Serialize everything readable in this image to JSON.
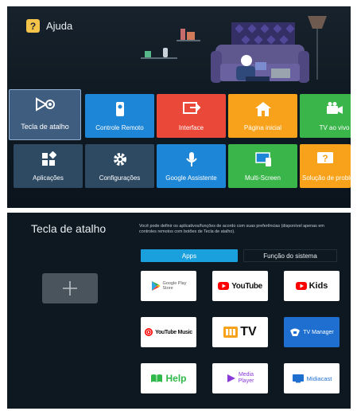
{
  "header": {
    "title": "Ajuda",
    "icon": "question-book-icon"
  },
  "tiles": [
    {
      "label": "Tecla de atalho",
      "icon": "shortcut-icon",
      "color": "#3f5d7f"
    },
    {
      "label": "Controle Remoto",
      "icon": "remote-icon",
      "color": "#1e86d6"
    },
    {
      "label": "Interface",
      "icon": "input-icon",
      "color": "#ea4838"
    },
    {
      "label": "Página inicial",
      "icon": "home-icon",
      "color": "#f7a21a"
    },
    {
      "label": "TV ao vivo",
      "icon": "tv-camera-icon",
      "color": "#39b54a"
    },
    {
      "label": "Aplicações",
      "icon": "apps-icon",
      "color": "#2e4a63"
    },
    {
      "label": "Configurações",
      "icon": "gear-icon",
      "color": "#2e4a63"
    },
    {
      "label": "Google Assistente",
      "icon": "microphone-icon",
      "color": "#1e86d6"
    },
    {
      "label": "Multi-Screen",
      "icon": "multiscreen-icon",
      "color": "#39b54a"
    },
    {
      "label": "Solução de problem...",
      "icon": "question-icon",
      "color": "#f7a21a"
    }
  ],
  "shortcut": {
    "title": "Tecla de atalho",
    "description": "Você pode definir os aplicativos/funções de acordo com suas preferências (disponível apenas em controles remotos com botões de Tecla de atalho).",
    "tabs": {
      "apps": "Apps",
      "system": "Função do sistema"
    },
    "apps": [
      {
        "line1": "Google Play",
        "line2": "Store",
        "icon": "google-play-icon",
        "color": "#555555"
      },
      {
        "line1": "YouTube",
        "line2": "",
        "icon": "youtube-icon",
        "color": "#111111"
      },
      {
        "line1": "Kids",
        "line2": "",
        "icon": "youtube-kids-icon",
        "color": "#111111"
      },
      {
        "line1": "YouTube Music",
        "line2": "",
        "icon": "youtube-music-icon",
        "color": "#111111"
      },
      {
        "line1": "TV",
        "line2": "",
        "icon": "tv-app-icon",
        "color": "#111111"
      },
      {
        "line1": "TV Manager",
        "line2": "",
        "icon": "tv-manager-icon",
        "color": "#ffffff"
      },
      {
        "line1": "Help",
        "line2": "",
        "icon": "help-book-icon",
        "color": "#2fb94a"
      },
      {
        "line1": "Media",
        "line2": "Player",
        "icon": "media-player-icon",
        "color": "#8a3ad8"
      },
      {
        "line1": "Midiacast",
        "line2": "",
        "icon": "midiacast-icon",
        "color": "#1f6fd1"
      }
    ]
  }
}
